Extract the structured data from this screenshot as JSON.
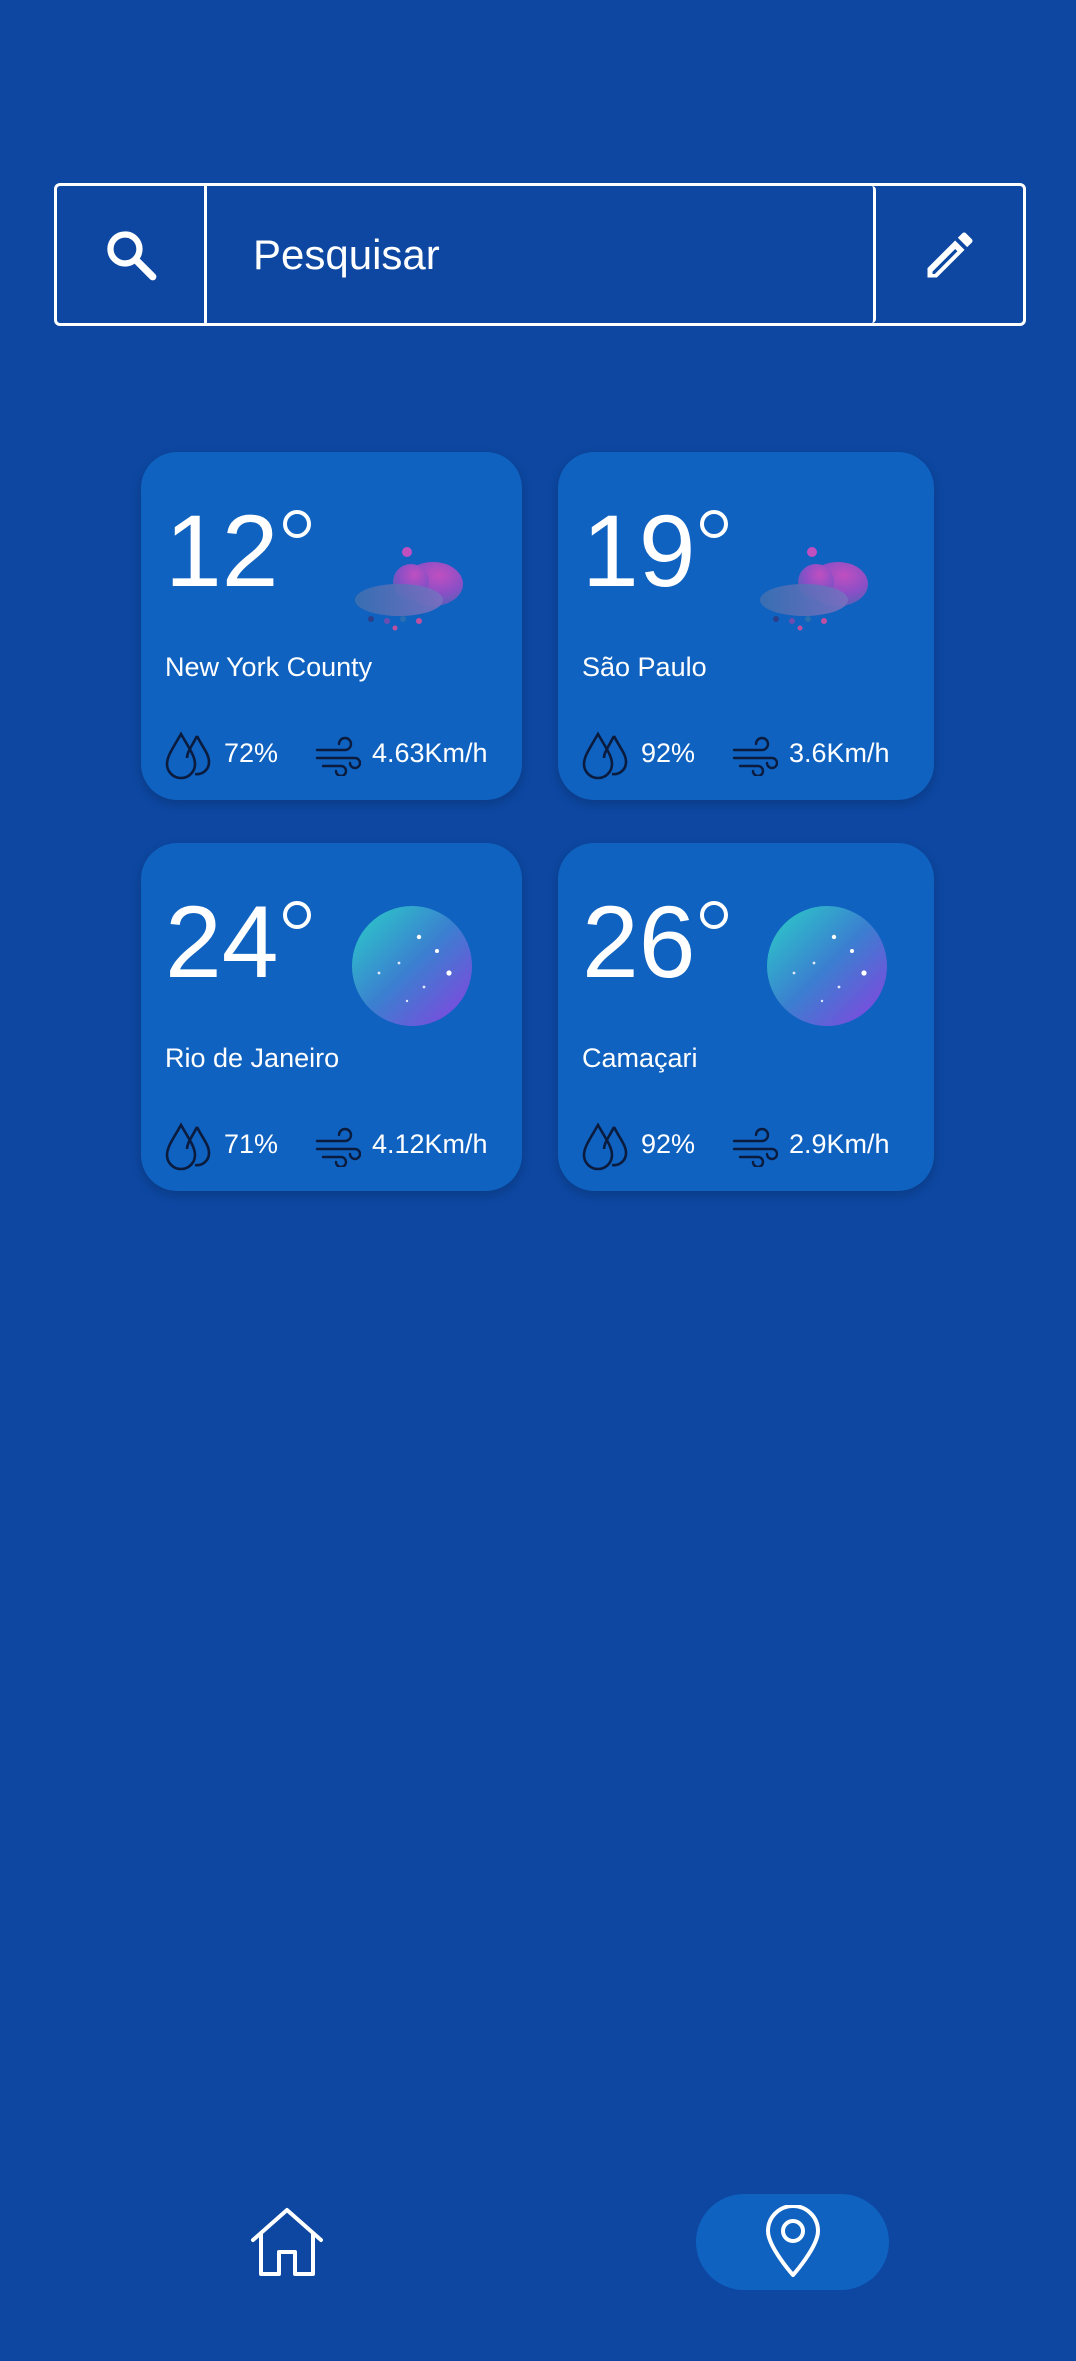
{
  "search": {
    "placeholder": "Pesquisar",
    "search_icon": "search-icon",
    "edit_icon": "pencil-icon"
  },
  "cities": [
    {
      "temp": "12",
      "name": "New York County",
      "humidity": "72%",
      "wind": "4.63Km/h",
      "icon": "rain-cloud-icon"
    },
    {
      "temp": "19",
      "name": "São Paulo",
      "humidity": "92%",
      "wind": "3.6Km/h",
      "icon": "rain-cloud-icon"
    },
    {
      "temp": "24",
      "name": "Rio de Janeiro",
      "humidity": "71%",
      "wind": "4.12Km/h",
      "icon": "night-moon-icon"
    },
    {
      "temp": "26",
      "name": "Camaçari",
      "humidity": "92%",
      "wind": "2.9Km/h",
      "icon": "night-moon-icon"
    }
  ],
  "nav": {
    "home_icon": "home-icon",
    "location_icon": "location-pin-icon"
  },
  "colors": {
    "background": "#0d47a1",
    "card": "#0f62c0",
    "text": "#ffffff"
  }
}
